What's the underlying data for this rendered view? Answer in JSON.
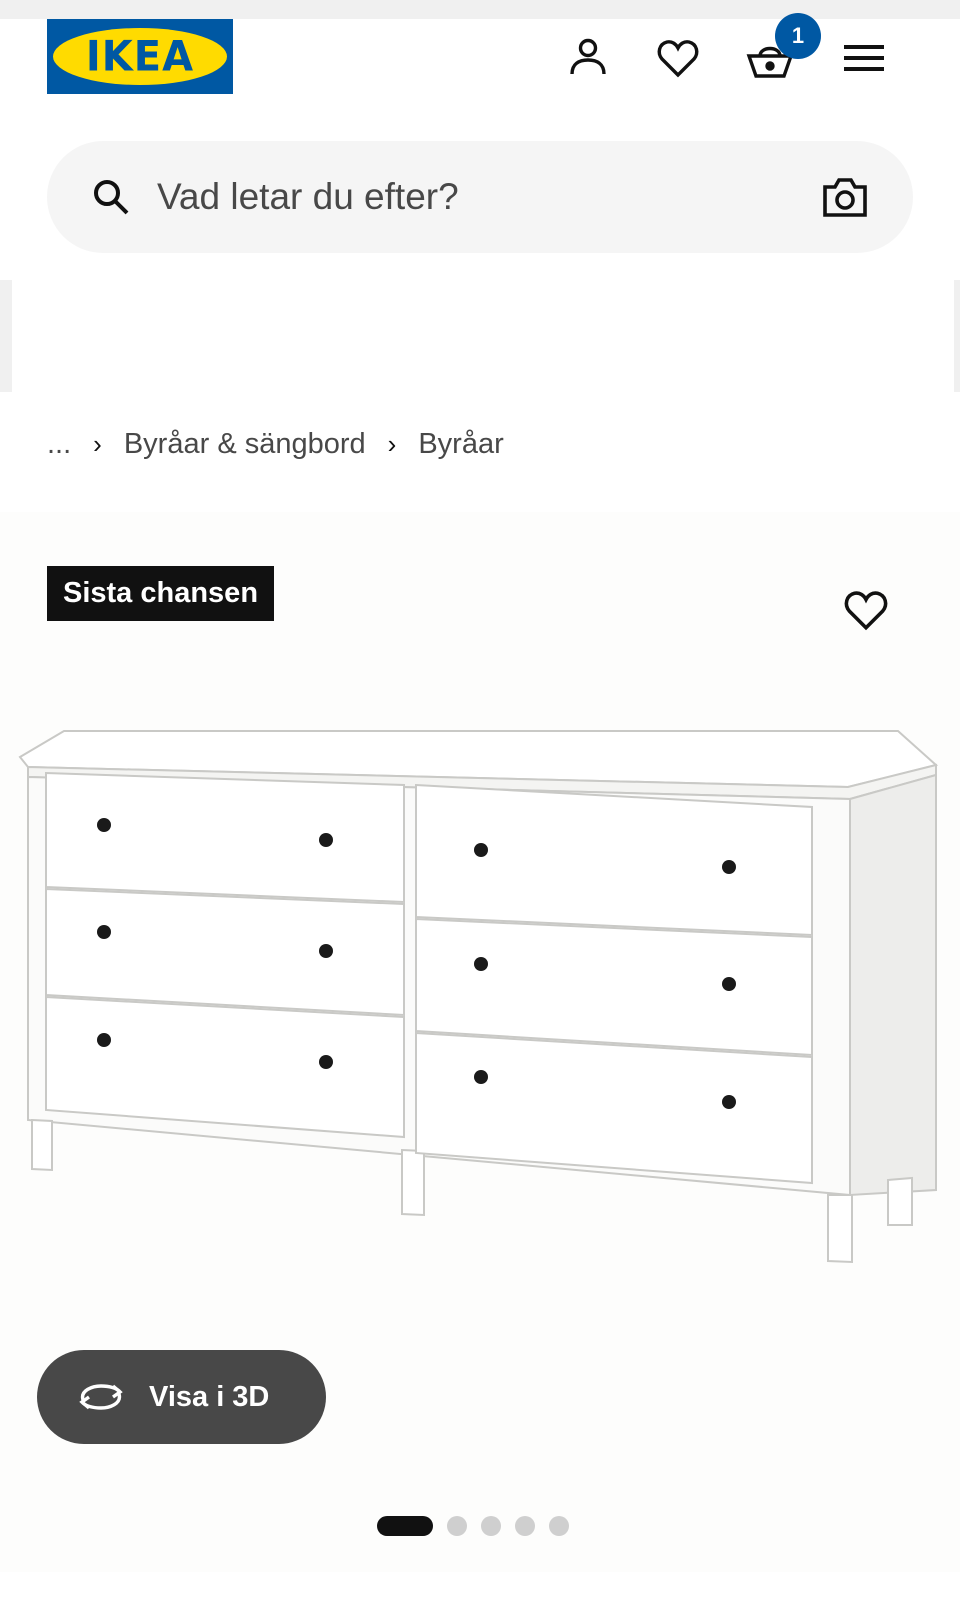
{
  "header": {
    "logo_text": "IKEA",
    "cart_count": "1",
    "icons": [
      "account-icon",
      "heart-icon",
      "cart-icon",
      "menu-icon"
    ]
  },
  "search": {
    "placeholder": "Vad letar du efter?",
    "icons": [
      "search-icon",
      "camera-icon"
    ]
  },
  "breadcrumb": {
    "items": [
      "...",
      "Byråar & sängbord",
      "Byråar"
    ]
  },
  "product": {
    "badge": "Sista chansen",
    "view_3d_label": "Visa i 3D",
    "carousel": {
      "count": 5,
      "active_index": 0
    }
  },
  "colors": {
    "brand_blue": "#0058a3",
    "brand_yellow": "#ffdb00",
    "dark_button": "#484848",
    "badge_black": "#111111"
  }
}
